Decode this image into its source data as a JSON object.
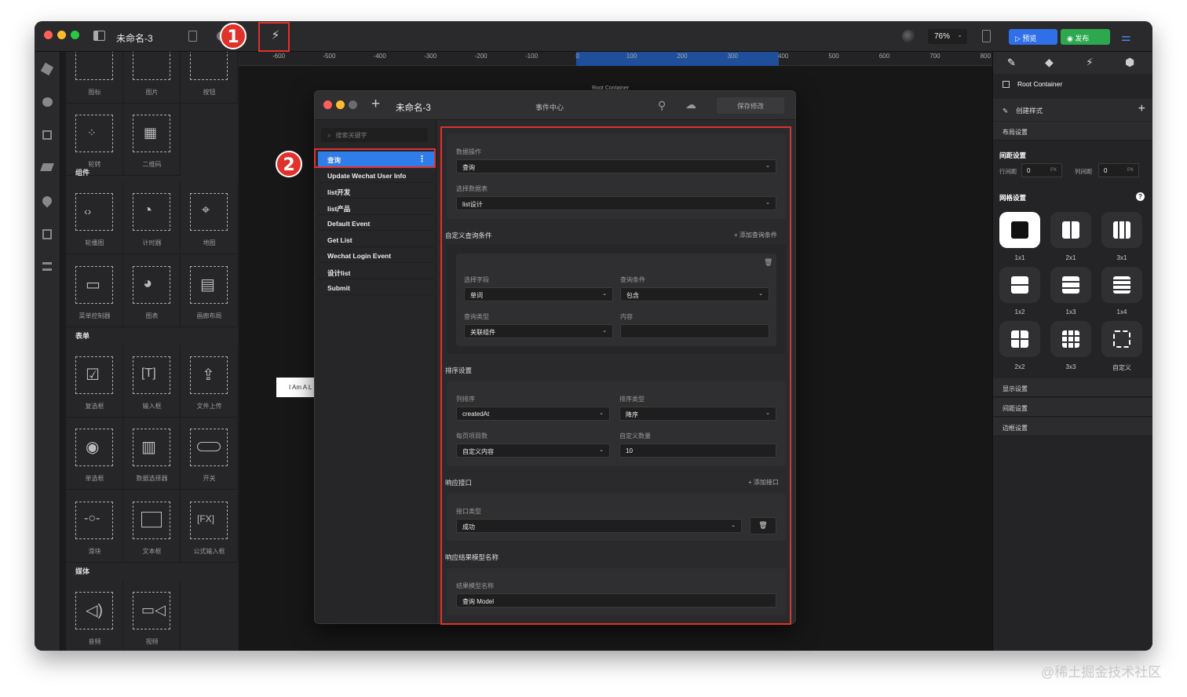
{
  "app": {
    "title": "未命名-3",
    "zoom": "76%",
    "preview_label": "预览",
    "publish_label": "发布"
  },
  "ruler": {
    "ticks": [
      "-600",
      "-500",
      "-400",
      "-300",
      "-200",
      "-100",
      "0",
      "100",
      "200",
      "300",
      "400",
      "500",
      "600",
      "700",
      "800"
    ]
  },
  "components": {
    "row0": [
      "图标",
      "图片",
      "按钮"
    ],
    "row1": [
      "轮转",
      "二维码"
    ],
    "sec_layout": "组件",
    "row2": [
      "轮播图",
      "计时器",
      "地图"
    ],
    "row3": [
      "菜单控制器",
      "图表",
      "画廊布局"
    ],
    "sec_form": "表单",
    "row4": [
      "复选框",
      "输入框",
      "文件上传"
    ],
    "row5": [
      "单选框",
      "数据选择器",
      "开关"
    ],
    "row6": [
      "滑块",
      "文本框",
      "公式输入框"
    ],
    "sec_media": "媒体",
    "row7": [
      "音频",
      "视频"
    ]
  },
  "canvas": {
    "root_label": "Root Container",
    "text_element": "I Am A L"
  },
  "dialog": {
    "title": "未命名-3",
    "center_title": "事件中心",
    "save_label": "保存修改",
    "search_placeholder": "搜索关键字",
    "events": [
      "查询",
      "Update Wechat User Info",
      "list开发",
      "list产品",
      "Default Event",
      "Get List",
      "Wechat Login Event",
      "设计list",
      "Submit"
    ],
    "data_op_label": "数据操作",
    "data_op_value": "查询",
    "table_label": "选择数据表",
    "table_value": "list设计",
    "custom_cond_header": "自定义查询条件",
    "add_cond_label": "添加查询条件",
    "field_label": "选择字段",
    "field_value": "单词",
    "cond_label": "查询条件",
    "cond_value": "包含",
    "qtype_label": "查询类型",
    "qtype_value": "关联组件",
    "content_label": "内容",
    "content_value": "",
    "sort_header": "排序设置",
    "sort_col_label": "列排序",
    "sort_col_value": "createdAt",
    "sort_type_label": "排序类型",
    "sort_type_value": "降序",
    "page_label": "每页项目数",
    "page_value": "自定义内容",
    "custom_count_label": "自定义数量",
    "custom_count_value": "10",
    "resp_header": "响应接口",
    "add_resp_label": "添加接口",
    "resp_type_label": "接口类型",
    "resp_type_value": "成功",
    "model_header": "响应结果模型名称",
    "model_label": "结果模型名称",
    "model_value": "查询 Model"
  },
  "right_panel": {
    "root": "Root Container",
    "create_style": "创建样式",
    "layout": "布局设置",
    "spacing": "间距设置",
    "row_gap_label": "行间距",
    "row_gap_value": "0",
    "col_gap_label": "列间距",
    "col_gap_value": "0",
    "unit": "PX",
    "grid_settings": "网格设置",
    "grids": [
      "1x1",
      "2x1",
      "3x1",
      "1x2",
      "1x3",
      "1x4",
      "2x2",
      "3x3",
      "自定义"
    ],
    "display": "显示设置",
    "spacing2": "间距设置",
    "border": "边框设置"
  },
  "annotations": {
    "badge1": "1",
    "badge2": "2"
  },
  "watermark": "@稀土掘金技术社区"
}
